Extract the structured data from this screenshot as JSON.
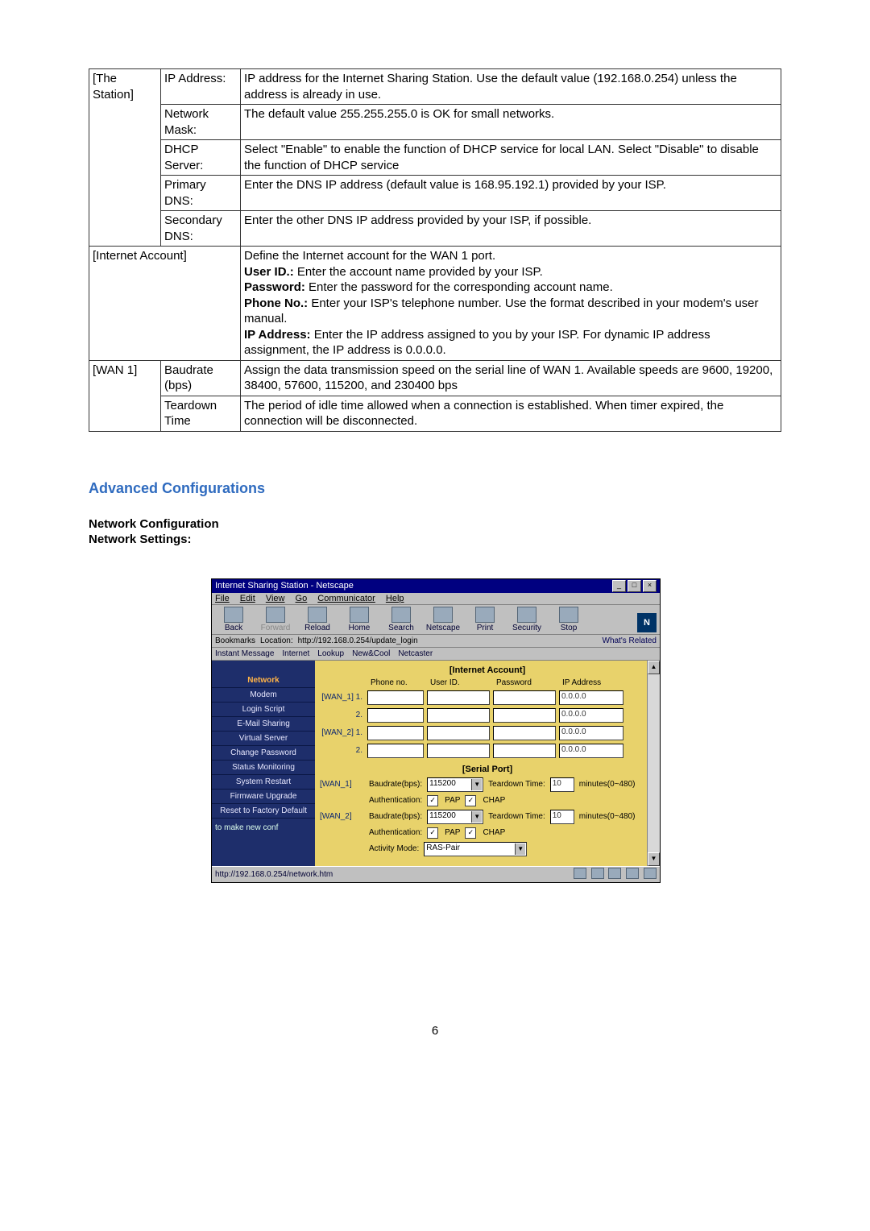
{
  "table": {
    "r0": {
      "group": "[The Station]",
      "label": "IP Address:",
      "desc": "IP address for the Internet Sharing Station. Use the default value (192.168.0.254) unless the address is already in use."
    },
    "r1": {
      "label": "Network Mask:",
      "desc": "The default value 255.255.255.0 is OK for small networks."
    },
    "r2": {
      "label": "DHCP Server:",
      "desc": "Select \"Enable\" to enable the function of DHCP service for local LAN. Select \"Disable\" to disable the function of DHCP service"
    },
    "r3": {
      "label": "Primary DNS:",
      "desc": "Enter the DNS IP address (default value is 168.95.192.1) provided by your ISP."
    },
    "r4": {
      "label": "Secondary DNS:",
      "desc": "Enter the other DNS IP address provided by your ISP, if possible."
    },
    "ia": {
      "group": "[Internet Account]",
      "l0": "Define the Internet account for the WAN 1 port.",
      "l1b": "User ID.:",
      "l1": " Enter the account name provided by your ISP.",
      "l2b": "Password:",
      "l2": " Enter the password for the corresponding account name.",
      "l3b": "Phone No.:",
      "l3": " Enter your ISP's telephone number. Use the format described in your modem's user manual.",
      "l4b": "IP Address:",
      "l4": " Enter the IP address assigned to you by your ISP. For dynamic IP address assignment, the IP address is 0.0.0.0."
    },
    "w1": {
      "group": "[WAN 1]",
      "r0l": "Baudrate (bps)",
      "r0d": "Assign the data transmission speed on the serial line of WAN 1. Available speeds are 9600, 19200, 38400, 57600, 115200, and 230400 bps",
      "r1l": "Teardown Time",
      "r1d": "The period of idle time allowed when a connection is established. When timer expired, the connection will be disconnected."
    }
  },
  "headings": {
    "advanced": "Advanced Configurations",
    "netconf": "Network Configuration",
    "netset": "Network Settings:"
  },
  "pageNumber": "6",
  "screenshot": {
    "title": "Internet Sharing Station - Netscape",
    "winbtns": {
      "min": "_",
      "max": "□",
      "close": "×"
    },
    "menu": {
      "file": "File",
      "edit": "Edit",
      "view": "View",
      "go": "Go",
      "comm": "Communicator",
      "help": "Help"
    },
    "toolbar": {
      "back": "Back",
      "forward": "Forward",
      "reload": "Reload",
      "home": "Home",
      "search": "Search",
      "netscape": "Netscape",
      "print": "Print",
      "security": "Security",
      "stop": "Stop"
    },
    "nlogo": "N",
    "locbar": {
      "bk": "Bookmarks",
      "loclabel": "Location:",
      "loc": "http://192.168.0.254/update_login",
      "whats": "What's Related"
    },
    "toolbar2": {
      "im": "Instant Message",
      "inet": "Internet",
      "lookup": "Lookup",
      "newcool": "New&Cool",
      "netcaster": "Netcaster"
    },
    "sidebar": {
      "items": [
        "Network",
        "Modem",
        "Login Script",
        "E-Mail Sharing",
        "Virtual Server",
        "Change Password",
        "Status Monitoring",
        "System Restart",
        "Firmware Upgrade",
        "Reset to Factory Default"
      ],
      "note": "to make new conf"
    },
    "internetAccount": {
      "section": "[Internet Account]",
      "cols": {
        "phone": "Phone no.",
        "user": "User ID.",
        "pass": "Password",
        "ip": "IP Address"
      },
      "rows": [
        {
          "lab": "[WAN_1] 1.",
          "ip": "0.0.0.0"
        },
        {
          "lab": "2.",
          "ip": "0.0.0.0"
        },
        {
          "lab": "[WAN_2] 1.",
          "ip": "0.0.0.0"
        },
        {
          "lab": "2.",
          "ip": "0.0.0.0"
        }
      ]
    },
    "serialPort": {
      "section": "[Serial Port]",
      "rows": [
        {
          "lab": "[WAN_1]",
          "baudLabel": "Baudrate(bps):",
          "baud": "115200",
          "ttLabel": "Teardown Time:",
          "tt": "10",
          "ttunit": "minutes(0~480)",
          "authLabel": "Authentication:",
          "pap": "PAP",
          "chap": "CHAP"
        },
        {
          "lab": "[WAN_2]",
          "baudLabel": "Baudrate(bps):",
          "baud": "115200",
          "ttLabel": "Teardown Time:",
          "tt": "10",
          "ttunit": "minutes(0~480)",
          "authLabel": "Authentication:",
          "pap": "PAP",
          "chap": "CHAP"
        }
      ],
      "activityLabel": "Activity Mode:",
      "activity": "RAS-Pair"
    },
    "status": "http://192.168.0.254/network.htm"
  }
}
